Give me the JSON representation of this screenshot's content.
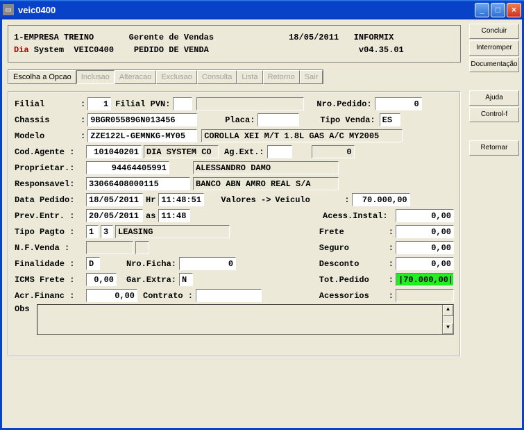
{
  "window": {
    "title": "veic0400"
  },
  "side": {
    "concluir": "Concluir",
    "interromper": "Interromper",
    "documentacao": "Documentação",
    "ajuda": "Ajuda",
    "controlf": "Control-f",
    "retornar": "Retornar"
  },
  "header": {
    "company": "1-EMPRESA TREINO",
    "role": "Gerente de Vendas",
    "date": "18/05/2011",
    "db": "INFORMIX",
    "dia": "Dia",
    "system": " System  VEIC0400",
    "screen": "PEDIDO DE VENDA",
    "version": "v04.35.01"
  },
  "toolbar": {
    "escolha": "Escolha a Opcao",
    "inclusao": "Inclusao",
    "alteracao": "Alteracao",
    "exclusao": "Exclusao",
    "consulta": "Consulta",
    "lista": "Lista",
    "retorno": "Retorno",
    "sair": "Sair"
  },
  "labels": {
    "filial": "Filial",
    "filial_pvn": "Filial PVN:",
    "nro_pedido": "Nro.Pedido:",
    "chassis": "Chassis",
    "placa": "Placa:",
    "tipo_venda": "Tipo Venda:",
    "modelo": "Modelo",
    "cod_agente": "Cod.Agente :",
    "ag_ext": "Ag.Ext.:",
    "proprietar": "Proprietar.:",
    "responsavel": "Responsavel:",
    "data_pedido": "Data Pedido:",
    "hr": "Hr",
    "valores": "Valores ->",
    "veiculo": "Veiculo",
    "prev_entr": "Prev.Entr. :",
    "as": "as",
    "acess_instal": "Acess.Instal:",
    "tipo_pagto": "Tipo Pagto :",
    "frete": "Frete",
    "nf_venda": "N.F.Venda  :",
    "seguro": "Seguro",
    "finalidade": "Finalidade :",
    "nro_ficha": "Nro.Ficha:",
    "desconto": "Desconto",
    "icms_frete": "ICMS Frete :",
    "gar_extra": "Gar.Extra:",
    "tot_pedido": "Tot.Pedido",
    "acr_financ": "Acr.Financ :",
    "contrato": "Contrato :",
    "acessorios": "Acessorios",
    "obs": "Obs"
  },
  "values": {
    "filial": "1",
    "filial_pvn": "",
    "filial_pvn_desc": "",
    "nro_pedido": "0",
    "chassis": "9BGR05589GN013456",
    "placa": "",
    "tipo_venda": "ES",
    "modelo_cod": "ZZE122L-GEMNKG-MY05",
    "modelo_desc": "COROLLA XEI M/T 1.8L GAS A/C MY2005",
    "cod_agente": "101040201",
    "cod_agente_desc": "DIA SYSTEM CO",
    "ag_ext": "",
    "ag_ext2": "0",
    "proprietar_cod": "94464405991",
    "proprietar_desc": "ALESSANDRO DAMO",
    "responsavel_cod": "33066408000115",
    "responsavel_desc": "BANCO ABN AMRO REAL S/A",
    "data_pedido": "18/05/2011",
    "hr": "11:48:51",
    "veiculo": "70.000,00",
    "prev_entr": "20/05/2011",
    "as": "11:48",
    "acess_instal": "0,00",
    "tipo_pagto1": "1",
    "tipo_pagto2": "3",
    "tipo_pagto_desc": "LEASING",
    "frete": "0,00",
    "nf_venda1": "",
    "nf_venda2": "",
    "seguro": "0,00",
    "finalidade": "D",
    "nro_ficha": "0",
    "desconto": "0,00",
    "icms_frete": "0,00",
    "gar_extra": "N",
    "tot_pedido": "|70.000,00|",
    "acr_financ": "0,00",
    "contrato": "",
    "acessorios": ""
  }
}
